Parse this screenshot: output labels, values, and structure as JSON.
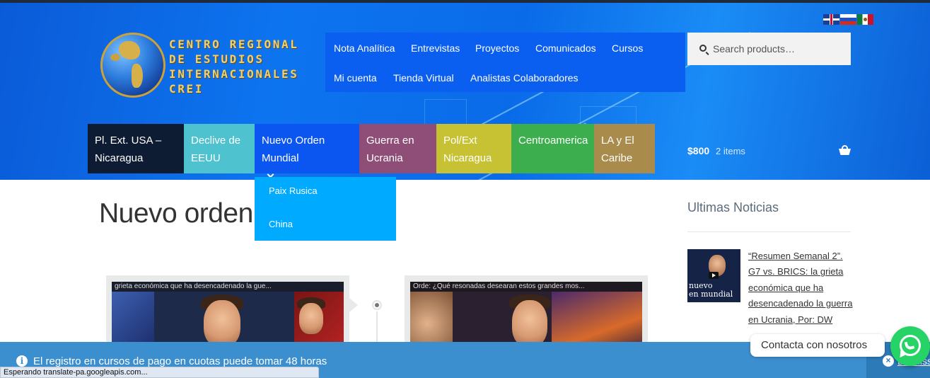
{
  "header": {
    "logo_lines": [
      "CENTRO REGIONAL",
      "DE ESTUDIOS",
      "INTERNACIONALES",
      "CREI"
    ],
    "flags": [
      "uk-flag-icon",
      "russia-flag-icon",
      "mexico-flag-icon"
    ]
  },
  "secondary_nav": [
    "Nota Analítica",
    "Entrevistas",
    "Proyectos",
    "Comunicados",
    "Cursos",
    "Mi cuenta",
    "Tienda Virtual",
    "Analistas Colaboradores"
  ],
  "search": {
    "placeholder": "Search products…",
    "icon": "search-icon"
  },
  "primary_nav": [
    {
      "lines": [
        "Pl. Ext. USA –",
        "Nicaragua"
      ],
      "color": "#0d1b33"
    },
    {
      "lines": [
        "Declive de",
        "EEUU"
      ],
      "color": "#4fc2cf"
    },
    {
      "lines": [
        "Nuevo Orden",
        "Mundial"
      ],
      "color": "#0b55f0",
      "has_dropdown": true
    },
    {
      "lines": [
        "Guerra en",
        "Ucrania"
      ],
      "color": "#8e4e78"
    },
    {
      "lines": [
        "Pol/Ext",
        "Nicaragua"
      ],
      "color": "#c6c234"
    },
    {
      "lines": [
        "Centroamerica"
      ],
      "color": "#3cae4e"
    },
    {
      "lines": [
        "LA y El",
        "Caribe"
      ],
      "color": "#a98b4c"
    }
  ],
  "dropdown": [
    "Paix Rusica",
    "China"
  ],
  "cart": {
    "amount": "$800",
    "count": "2 items",
    "icon": "basket-icon"
  },
  "main": {
    "title": "Nuevo orden m",
    "cards": [
      {
        "caption": "grieta económica que ha desencadenado la gue..."
      },
      {
        "caption": "Orde: ¿Qué resonadas desearan estos grandes mos..."
      }
    ]
  },
  "sidebar": {
    "title": "Ultimas Noticias",
    "thumb_text": [
      "nuevo",
      "en mundial"
    ],
    "link": "“Resumen Semanal 2”. G7 vs. BRICS: la grieta económica que ha desencadenado la guerra en Ucrania, Por: DW"
  },
  "notice": {
    "message": "El registro en cursos de pago en cuotas puede tomar 48 horas",
    "dismiss": "Dismiss"
  },
  "whatsapp": {
    "label": "Contacta con nosotros"
  },
  "status_bar": "Esperando translate-pa.googleapis.com..."
}
